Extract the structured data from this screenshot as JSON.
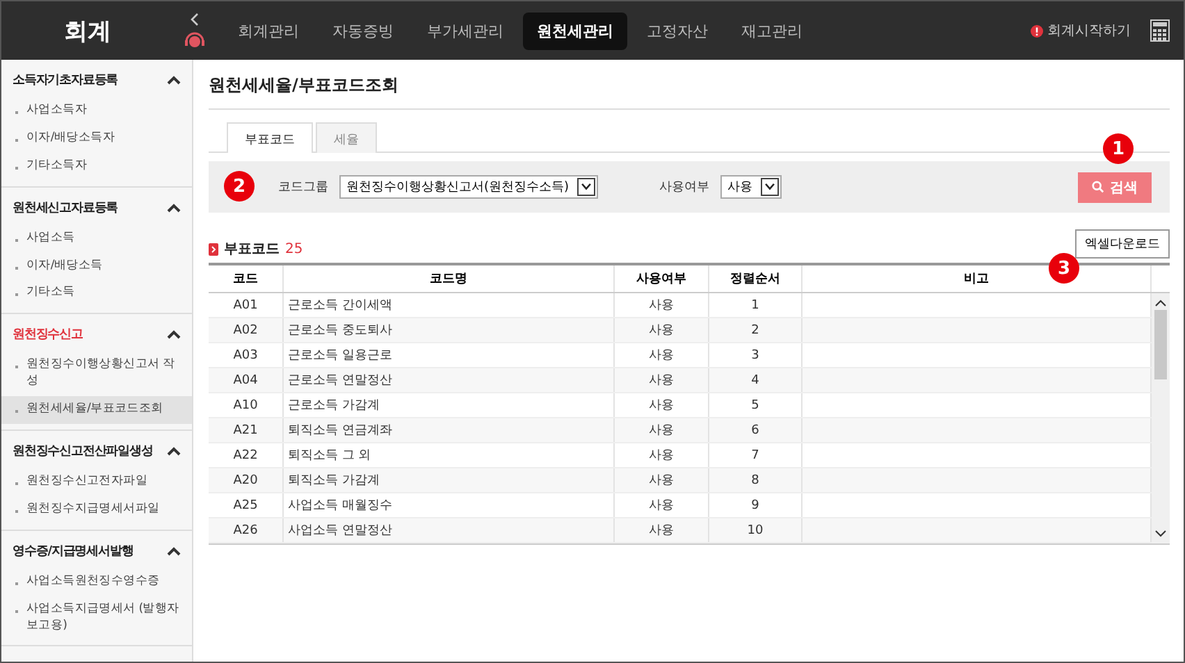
{
  "app": {
    "title": "회계"
  },
  "nav": [
    {
      "label": "회계관리",
      "selected": false
    },
    {
      "label": "자동증빙",
      "selected": false
    },
    {
      "label": "부가세관리",
      "selected": false
    },
    {
      "label": "원천세관리",
      "selected": true
    },
    {
      "label": "고정자산",
      "selected": false
    },
    {
      "label": "재고관리",
      "selected": false
    }
  ],
  "start_link": "회계시작하기",
  "sidebar": [
    {
      "title": "소득자기초자료등록",
      "active": false,
      "expanded": true,
      "items": [
        {
          "label": "사업소득자",
          "selected": false
        },
        {
          "label": "이자/배당소득자",
          "selected": false
        },
        {
          "label": "기타소득자",
          "selected": false
        }
      ]
    },
    {
      "title": "원천세신고자료등록",
      "active": false,
      "expanded": true,
      "items": [
        {
          "label": "사업소득",
          "selected": false
        },
        {
          "label": "이자/배당소득",
          "selected": false
        },
        {
          "label": "기타소득",
          "selected": false
        }
      ]
    },
    {
      "title": "원천징수신고",
      "active": true,
      "expanded": true,
      "items": [
        {
          "label": "원천징수이행상황신고서 작성",
          "selected": false
        },
        {
          "label": "원천세세율/부표코드조회",
          "selected": true
        }
      ]
    },
    {
      "title": "원천징수신고전산파일생성",
      "active": false,
      "expanded": true,
      "items": [
        {
          "label": "원천징수신고전자파일",
          "selected": false
        },
        {
          "label": "원천징수지급명세서파일",
          "selected": false
        }
      ]
    },
    {
      "title": "영수증/지급명세서발행",
      "active": false,
      "expanded": true,
      "items": [
        {
          "label": "사업소득원천징수영수증",
          "selected": false
        },
        {
          "label": "사업소득지급명세서 (발행자보고용)",
          "selected": false
        }
      ]
    }
  ],
  "page_title": "원천세세율/부표코드조회",
  "tabs": [
    {
      "label": "부표코드",
      "selected": true
    },
    {
      "label": "세율",
      "selected": false
    }
  ],
  "filters": [
    {
      "label": "코드그룹",
      "value": "원천징수이행상황신고서(원천징수소득)"
    },
    {
      "label": "사용여부",
      "value": "사용"
    }
  ],
  "search_button": "검색",
  "result": {
    "title": "부표코드",
    "count": "25"
  },
  "excel_button": "엑셀다운로드",
  "table": {
    "columns": [
      "코드",
      "코드명",
      "사용여부",
      "정렬순서",
      "비고"
    ],
    "rows": [
      [
        "A01",
        "근로소득 간이세액",
        "사용",
        "1",
        ""
      ],
      [
        "A02",
        "근로소득 중도퇴사",
        "사용",
        "2",
        ""
      ],
      [
        "A03",
        "근로소득 일용근로",
        "사용",
        "3",
        ""
      ],
      [
        "A04",
        "근로소득 연말정산",
        "사용",
        "4",
        ""
      ],
      [
        "A10",
        "근로소득 가감계",
        "사용",
        "5",
        ""
      ],
      [
        "A21",
        "퇴직소득 연금계좌",
        "사용",
        "6",
        ""
      ],
      [
        "A22",
        "퇴직소득 그 외",
        "사용",
        "7",
        ""
      ],
      [
        "A20",
        "퇴직소득 가감계",
        "사용",
        "8",
        ""
      ],
      [
        "A25",
        "사업소득 매월징수",
        "사용",
        "9",
        ""
      ],
      [
        "A26",
        "사업소득 연말정산",
        "사용",
        "10",
        ""
      ]
    ]
  },
  "callouts": [
    "1",
    "2",
    "3"
  ]
}
